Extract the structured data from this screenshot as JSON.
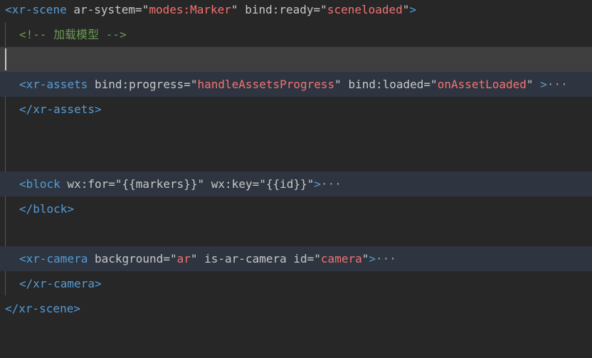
{
  "lines": {
    "l1": {
      "open": "<",
      "tag": "xr-scene",
      "a1": "ar-system",
      "v1": "modes:Marker",
      "a2": "bind:ready",
      "v2": "sceneloaded",
      "close": ">"
    },
    "l2": {
      "comment": "<!-- 加载模型 -->"
    },
    "l4": {
      "open": "<",
      "tag": "xr-assets",
      "a1": "bind:progress",
      "v1": "handleAssetsProgress",
      "a2": "bind:loaded",
      "v2": "onAssetLoaded",
      "close": ">",
      "fold": "···"
    },
    "l5": {
      "text": "</xr-assets>"
    },
    "l8": {
      "open": "<",
      "tag": "block",
      "a1": "wx:for",
      "v1": "{{markers}}",
      "a2": "wx:key",
      "v2": "{{id}}",
      "close": ">",
      "fold": "···"
    },
    "l9": {
      "text": "</block>"
    },
    "l11": {
      "open": "<",
      "tag": "xr-camera",
      "a1": "background",
      "v1": "ar",
      "a2": "is-ar-camera",
      "a3": "id",
      "v3": "camera",
      "close": ">",
      "fold": "···"
    },
    "l12": {
      "text": "</xr-camera>"
    },
    "l13": {
      "text": "</xr-scene>"
    }
  }
}
